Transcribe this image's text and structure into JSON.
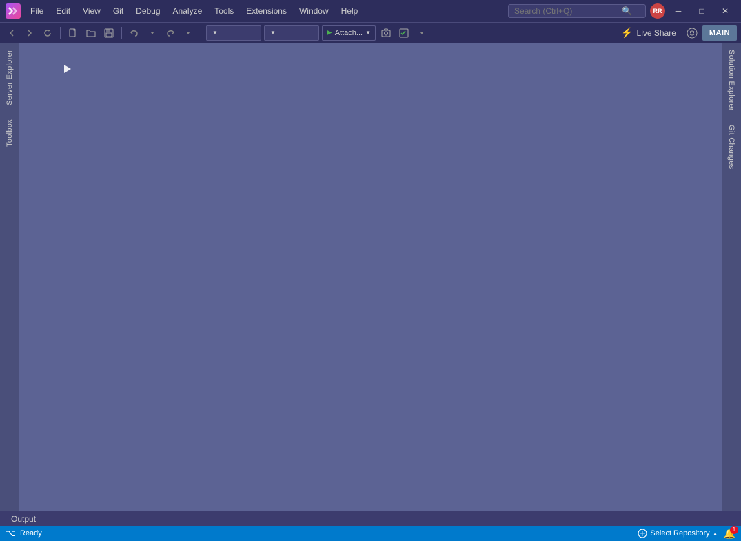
{
  "titlebar": {
    "logo_text": "VS",
    "menu_items": [
      "File",
      "Edit",
      "View",
      "Git",
      "Debug",
      "Analyze",
      "Tools",
      "Extensions",
      "Window",
      "Help"
    ],
    "search_placeholder": "Search (Ctrl+Q)",
    "search_icon": "🔍",
    "avatar_initials": "RR",
    "minimize_icon": "─",
    "restore_icon": "□",
    "close_icon": "✕"
  },
  "toolbar": {
    "back_icon": "◁",
    "forward_icon": "▷",
    "undo_icon": "↩",
    "redo_icon": "↪",
    "new_project_icon": "📄",
    "open_icon": "📂",
    "save_icon": "💾",
    "dropdown1_placeholder": "",
    "dropdown2_placeholder": "",
    "attach_label": "Attach...",
    "play_icon": "▶",
    "live_share_label": "Live Share",
    "feedback_icon": "☺",
    "main_label": "MAIN"
  },
  "left_sidebar": {
    "tabs": [
      "Server Explorer",
      "Toolbox"
    ]
  },
  "right_sidebar": {
    "tabs": [
      "Solution Explorer",
      "Git Changes"
    ]
  },
  "output_bar": {
    "tab_label": "Output"
  },
  "statusbar": {
    "ready_label": "Ready",
    "git_icon": "⌥",
    "repo_label": "Select Repository",
    "repo_arrow": "▲",
    "bell_count": "1",
    "branch_icon": "⎇"
  }
}
